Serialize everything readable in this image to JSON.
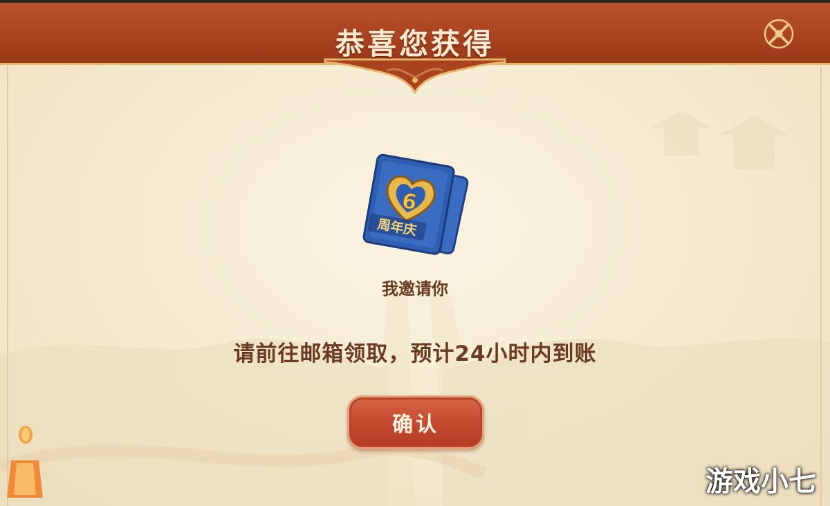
{
  "dialog": {
    "title": "恭喜您获得",
    "close_icon": "close-x-icon"
  },
  "reward": {
    "icon": "anniversary-card-icon",
    "badge_text": "周年庆",
    "name": "我邀请你"
  },
  "notice": "请前往邮箱领取，预计24小时内到账",
  "confirm_button": {
    "label": "确认"
  },
  "watermark": "游戏小七",
  "colors": {
    "header": "#a9431f",
    "header_border": "#e8b56a",
    "panel": "#f5ead0",
    "text": "#6b3a22",
    "button": "#c54a2f",
    "card_blue": "#2f5fb3",
    "card_gold": "#e9b84a"
  }
}
